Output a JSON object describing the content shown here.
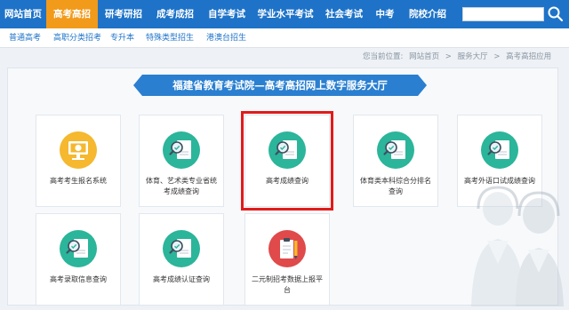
{
  "nav": {
    "items": [
      {
        "label": "网站首页",
        "active": false
      },
      {
        "label": "高考高招",
        "active": true
      },
      {
        "label": "研考研招",
        "active": false
      },
      {
        "label": "成考成招",
        "active": false
      },
      {
        "label": "自学考试",
        "active": false
      },
      {
        "label": "学业水平考试",
        "active": false
      },
      {
        "label": "社会考试",
        "active": false
      },
      {
        "label": "中考",
        "active": false
      },
      {
        "label": "院校介绍",
        "active": false
      }
    ],
    "search_icon": "search-icon"
  },
  "subnav": {
    "items": [
      "普通高考",
      "高职分类招考",
      "专升本",
      "特殊类型招生",
      "港澳台招生"
    ]
  },
  "breadcrumb": {
    "prefix": "您当前位置:",
    "items": [
      "网站首页",
      "服务大厅",
      "高考高招应用"
    ],
    "separator": ">"
  },
  "banner": {
    "title": "福建省教育考试院—高考高招网上数字服务大厅"
  },
  "services": [
    {
      "label": "高考考生报名系统",
      "icon": "monitor-yuan-icon"
    },
    {
      "label": "体育、艺术类专业省统考成绩查询",
      "icon": "score-search-icon"
    },
    {
      "label": "高考成绩查询",
      "icon": "score-search-icon",
      "highlighted": true
    },
    {
      "label": "体育类本科综合分排名查询",
      "icon": "score-search-icon"
    },
    {
      "label": "高考外语口试成绩查询",
      "icon": "score-search-icon"
    },
    {
      "label": "高考录取信息查询",
      "icon": "score-search-icon"
    },
    {
      "label": "高考成绩认证查询",
      "icon": "score-search-icon"
    },
    {
      "label": "二元制招考数据上报平台",
      "icon": "clipboard-pencil-icon"
    }
  ],
  "colors": {
    "nav_bg": "#1e73c8",
    "nav_active": "#f29a1a",
    "banner_bg": "#2a7fd0",
    "icon_green": "#2bb59a",
    "icon_yellow": "#f5b82e",
    "icon_red": "#e04a4a",
    "highlight_border": "#e11b1b"
  }
}
